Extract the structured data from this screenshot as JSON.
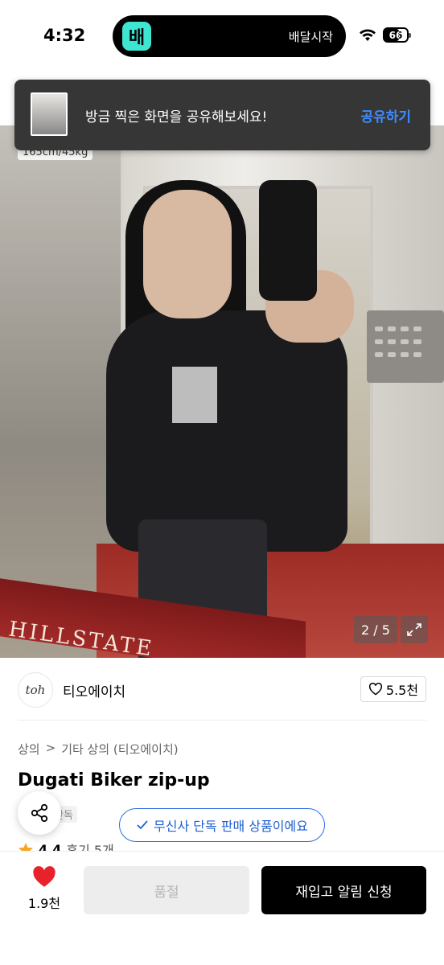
{
  "status_bar": {
    "time": "4:32",
    "island_app_glyph": "배",
    "island_text": "배달시작",
    "battery_percent": 66,
    "battery_label": "66"
  },
  "share_banner": {
    "message": "방금 찍은 화면을 공유해보세요!",
    "action_label": "공유하기"
  },
  "hero": {
    "size_info": "165cm/45kg",
    "sign_text": "HILLSTATE",
    "counter": "2 / 5"
  },
  "brand": {
    "logo_text": "toh",
    "name": "티오에이치",
    "likes": "5.5천"
  },
  "breadcrumb": {
    "items": [
      "상의",
      "기타 상의 (티오에이치)"
    ],
    "separator": ">"
  },
  "product": {
    "title": "Dugati Biker zip-up",
    "exclusive_tag": "단독",
    "exclusive_badge": "무신사 단독 판매 상품이에요",
    "rating": "4.4",
    "reviews": "후기 5개"
  },
  "bottom_bar": {
    "wish_count": "1.9천",
    "soldout_label": "품절",
    "restock_label": "재입고 알림 신청"
  },
  "colors": {
    "accent_blue": "#1f5fd1",
    "banner_action": "#3f8cff",
    "heart_red": "#e8212b",
    "star_orange": "#f5a623"
  }
}
